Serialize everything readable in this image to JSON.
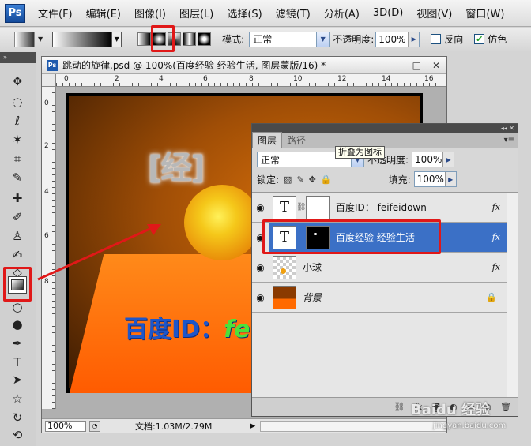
{
  "menubar": {
    "logo": "Ps",
    "items": [
      "文件(F)",
      "编辑(E)",
      "图像(I)",
      "图层(L)",
      "选择(S)",
      "滤镜(T)",
      "分析(A)",
      "3D(D)",
      "视图(V)",
      "窗口(W)"
    ]
  },
  "options": {
    "mode_label": "模式:",
    "mode_value": "正常",
    "opacity_label": "不透明度:",
    "opacity_value": "100%",
    "reverse_label": "反向",
    "dither_label": "仿色",
    "dither_checked": true,
    "selected_gradient_type": "radial"
  },
  "document": {
    "title": "跳动的旋律.psd @ 100%(百度经验 经验生活, 图层蒙版/16) *",
    "ruler_top": [
      "0",
      "2",
      "4",
      "6",
      "8",
      "10",
      "12",
      "14",
      "16"
    ],
    "ruler_left": [
      "0",
      "2",
      "4",
      "6",
      "8"
    ],
    "canvas_glyph": "经",
    "canvas_text_main": "百度ID：",
    "canvas_text_fe": "fe",
    "zoom": "100%",
    "doc_size": "文档:1.03M/2.79M"
  },
  "layers_panel": {
    "tabs": [
      "图层",
      "路径"
    ],
    "tooltip": "折叠为图标",
    "blend_mode": "正常",
    "opacity_label": "不透明度:",
    "opacity_value": "100%",
    "lock_label": "锁定:",
    "fill_label": "填充:",
    "fill_value": "100%",
    "layers": [
      {
        "name": "百度ID： feifeidown",
        "thumb": "T",
        "fx": "fx"
      },
      {
        "name": "百度经验 经验生活",
        "thumb": "T",
        "fx": "fx",
        "selected": true
      },
      {
        "name": "小球",
        "fx": "fx"
      },
      {
        "name": "背景"
      }
    ],
    "footer_icons": [
      "link-icon",
      "fx-icon",
      "mask-icon",
      "adjustment-icon",
      "folder-icon",
      "new-layer-icon",
      "trash-icon"
    ]
  },
  "watermark": {
    "brand": "Baidu 经验",
    "url": "jingyan.baidu.com"
  }
}
